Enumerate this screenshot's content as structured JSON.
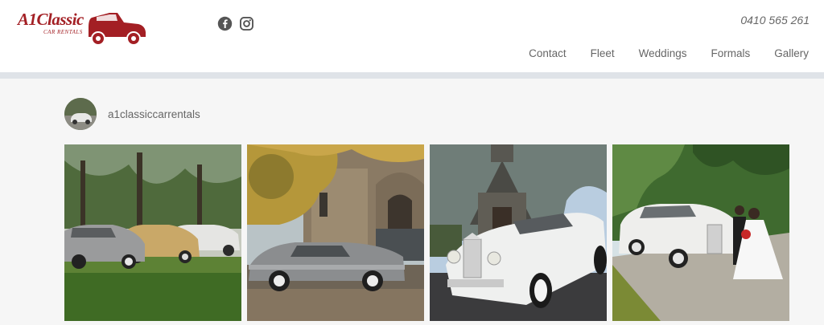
{
  "header": {
    "logo_text": "A1Classic",
    "logo_subtext": "CAR RENTALS",
    "phone": "0410 565 261",
    "social": [
      {
        "name": "facebook-icon"
      },
      {
        "name": "instagram-icon"
      }
    ]
  },
  "nav": {
    "items": [
      {
        "label": "Contact"
      },
      {
        "label": "Fleet"
      },
      {
        "label": "Weddings"
      },
      {
        "label": "Formals"
      },
      {
        "label": "Gallery"
      }
    ]
  },
  "feed": {
    "handle": "a1classiccarrentals"
  },
  "colors": {
    "brand": "#a31f24",
    "header_bg": "#ffffff",
    "page_bg": "#f6f6f6",
    "divider": "#dfe3e8",
    "text": "#666666"
  }
}
